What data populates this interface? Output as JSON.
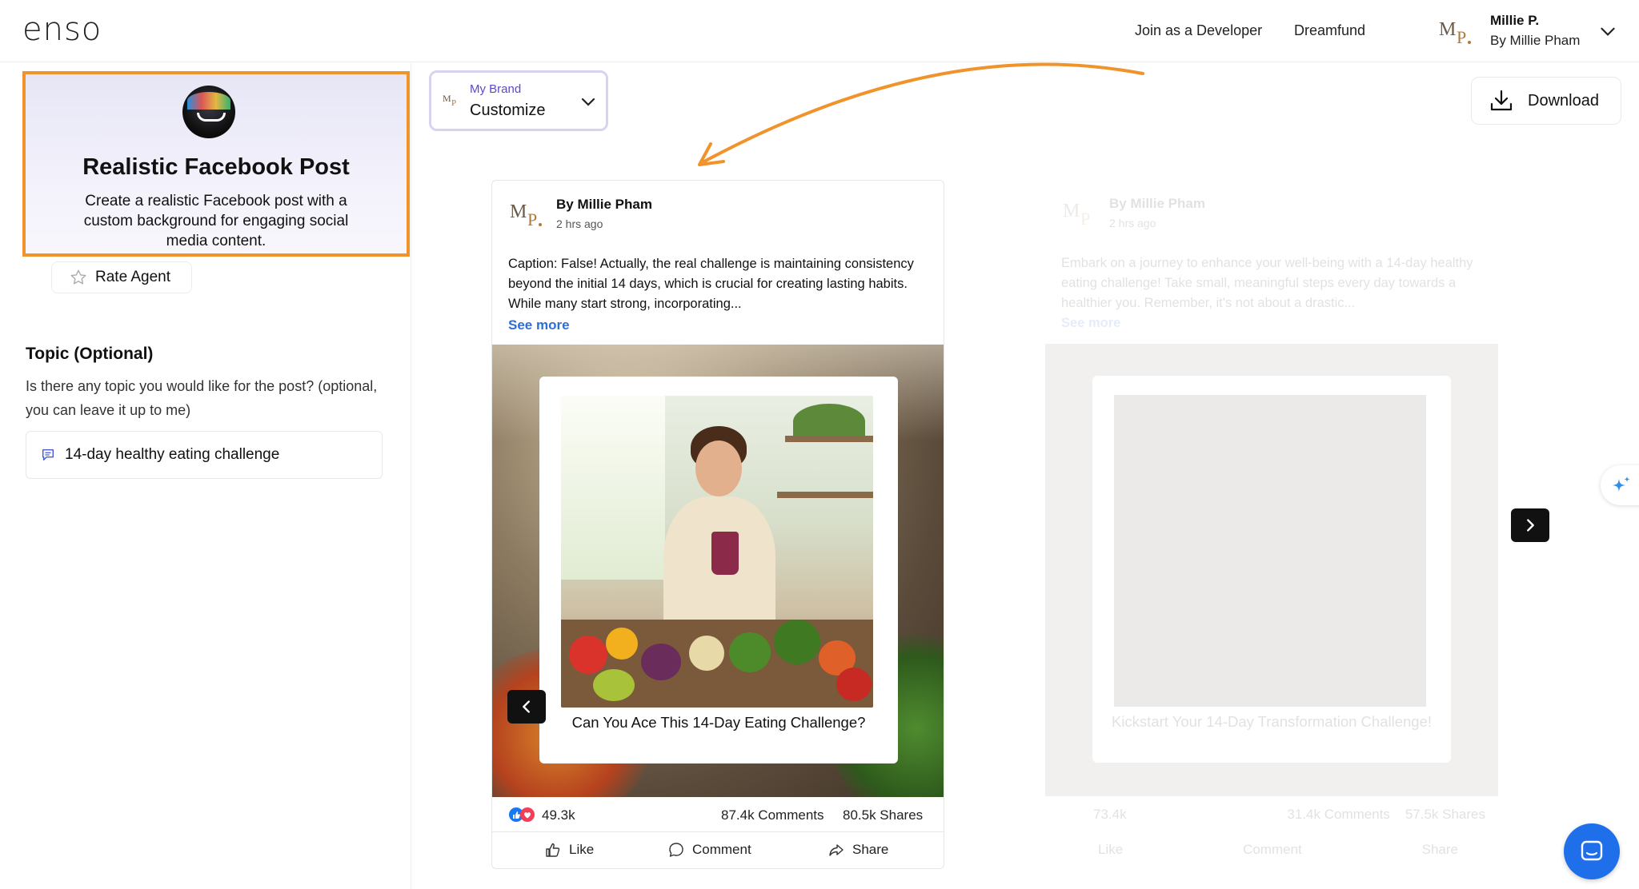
{
  "header": {
    "logo": "enso",
    "nav": {
      "developer": "Join as a Developer",
      "dreamfund": "Dreamfund"
    },
    "user": {
      "name": "Millie P.",
      "subtitle": "By Millie Pham"
    }
  },
  "agent": {
    "title": "Realistic Facebook Post",
    "description": "Create a realistic Facebook post with a custom background for engaging social media content.",
    "rate_label": "Rate Agent"
  },
  "topic": {
    "title": "Topic (Optional)",
    "description": "Is there any topic you would like for the post? (optional, you can leave it up to me)",
    "value": "14-day healthy eating challenge"
  },
  "brand": {
    "label": "My Brand",
    "value": "Customize"
  },
  "download_label": "Download",
  "post": {
    "author": "By Millie Pham",
    "time": "2 hrs ago",
    "caption": "Caption: False! Actually, the real challenge is maintaining consistency beyond the initial 14 days, which is crucial for creating lasting habits. While many start strong, incorporating...",
    "see_more": "See more",
    "media_caption": "Can You Ace This 14-Day Eating Challenge?",
    "likes": "49.3k",
    "comments": "87.4k Comments",
    "shares": "80.5k Shares",
    "actions": {
      "like": "Like",
      "comment": "Comment",
      "share": "Share"
    }
  },
  "next_post": {
    "author": "By Millie Pham",
    "time": "2 hrs ago",
    "caption": "Embark on a journey to enhance your well-being with a 14-day healthy eating challenge! Take small, meaningful steps every day towards a healthier you. Remember, it's not about a drastic...",
    "see_more": "See more",
    "media_caption": "Kickstart Your 14-Day Transformation Challenge!",
    "likes": "73.4k",
    "comments": "31.4k Comments",
    "shares": "57.5k Shares",
    "actions": {
      "like": "Like",
      "comment": "Comment",
      "share": "Share"
    }
  },
  "colors": {
    "accent": "#f0932b",
    "brand_purple": "#5b49c9",
    "link_blue": "#2d6ed8",
    "chat_blue": "#1f6feb"
  },
  "icons": [
    "user-avatar-logo",
    "chevron-down-icon",
    "star-icon",
    "chat-bubble-icon",
    "download-icon",
    "chevron-left-icon",
    "chevron-right-icon",
    "thumbs-up-icon",
    "comment-icon",
    "share-icon",
    "sparkle-icon",
    "messenger-icon"
  ]
}
